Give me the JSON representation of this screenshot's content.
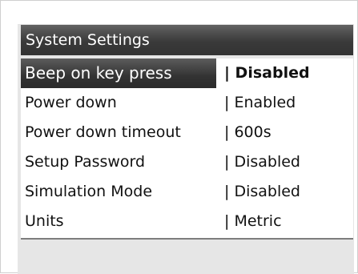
{
  "title": "System Settings",
  "settings": [
    {
      "label": "Beep on key press",
      "value": "| Disabled",
      "selected": true
    },
    {
      "label": "Power down",
      "value": "| Enabled",
      "selected": false
    },
    {
      "label": "Power down timeout",
      "value": "| 600s",
      "selected": false
    },
    {
      "label": "Setup Password",
      "value": "| Disabled",
      "selected": false
    },
    {
      "label": "Simulation Mode",
      "value": "| Disabled",
      "selected": false
    },
    {
      "label": "Units",
      "value": "| Metric",
      "selected": false
    }
  ],
  "colors": {
    "title_bar": "#3a3a3a",
    "selected_row": "#333333",
    "screen_background": "#e6e6e6",
    "list_background": "#ffffff"
  }
}
